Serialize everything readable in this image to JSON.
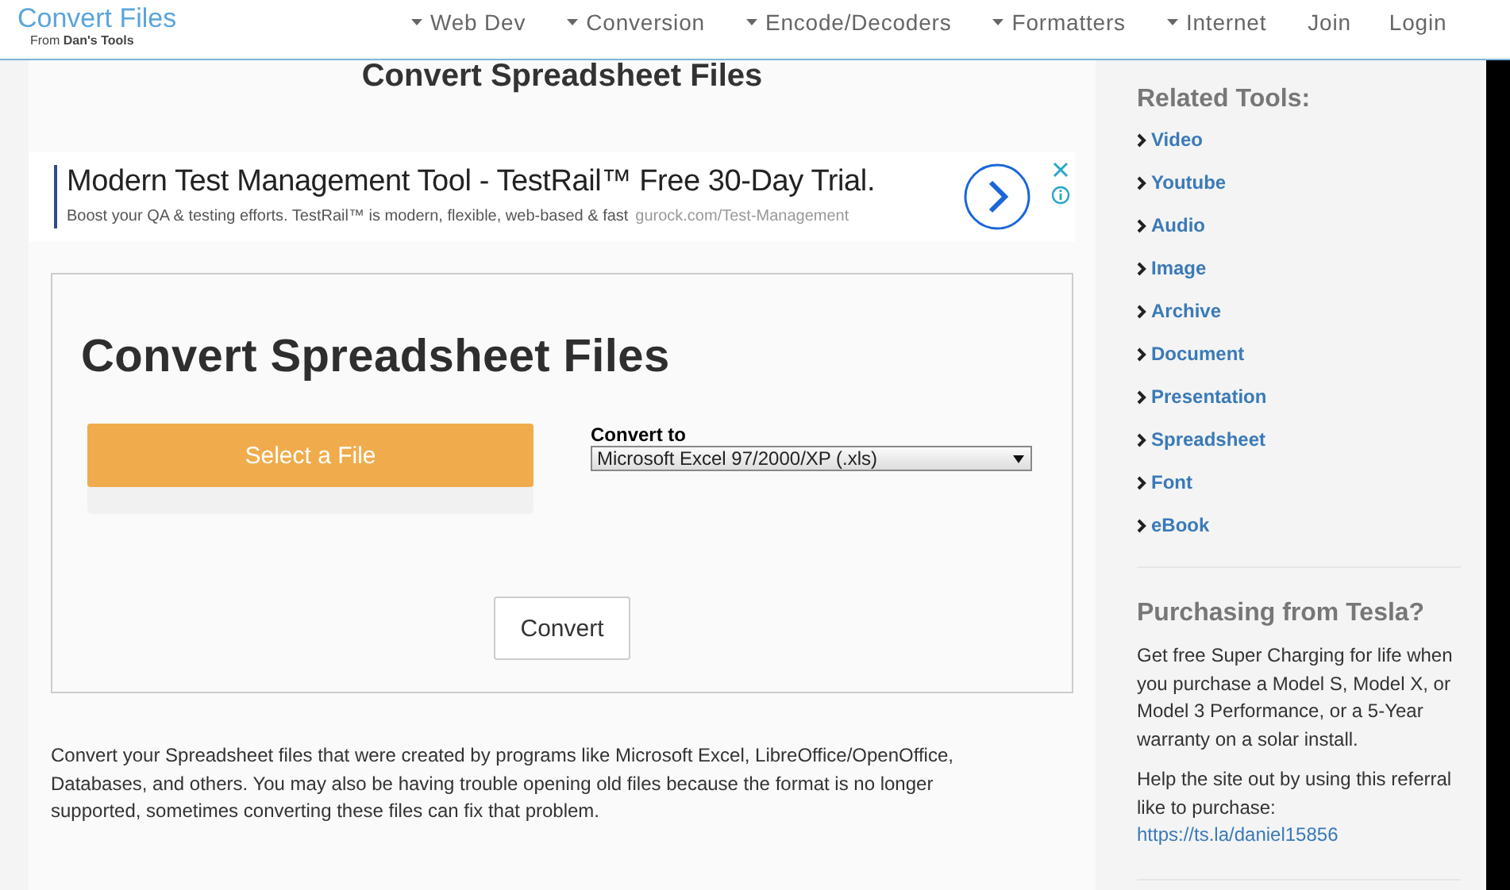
{
  "brand": {
    "title": "Convert Files",
    "subtitle": "From **Dan's Tools**"
  },
  "nav": [
    {
      "label": "Web Dev",
      "kind": "dropdown"
    },
    {
      "label": "Conversion",
      "kind": "dropdown"
    },
    {
      "label": "Encode/Decoders",
      "kind": "dropdown"
    },
    {
      "label": "Formatters",
      "kind": "dropdown"
    },
    {
      "label": "Internet",
      "kind": "dropdown"
    },
    {
      "label": "Join",
      "kind": "link"
    },
    {
      "label": "Login",
      "kind": "link"
    }
  ],
  "page_title": "Convert Spreadsheet Files",
  "ad": {
    "headline": "Modern Test Management Tool - TestRail™ Free 30-Day Trial.",
    "body": "Boost your QA & testing efforts. TestRail™ is modern, flexible, web-based & fast",
    "url": "gurock.com/Test-Management"
  },
  "converter": {
    "title": "Convert Spreadsheet Files",
    "select_button": "Select a File",
    "convert_to_label": "Convert to",
    "format_value": "Microsoft Excel 97/2000/XP (.xls)",
    "convert_button": "Convert"
  },
  "description": "Convert your Spreadsheet files that were created by programs like Microsoft Excel, LibreOffice/OpenOffice, Databases, and others. You may also be having trouble opening old files because the format is no longer supported, sometimes converting these files can fix that problem.",
  "sidebar": {
    "related_title": "Related Tools:",
    "related_links": [
      "Video",
      "Youtube",
      "Audio",
      "Image",
      "Archive",
      "Document",
      "Presentation",
      "Spreadsheet",
      "Font",
      "eBook"
    ],
    "promo": {
      "title": "Purchasing from Tesla?",
      "text": "Get free Super Charging for life when you purchase a Model S, Model X, or Model 3 Performance, or a 5-Year warranty on a solar install.",
      "referral_text": "Help the site out by using this referral like to purchase:",
      "referral_link": "https://ts.la/daniel15856"
    }
  }
}
